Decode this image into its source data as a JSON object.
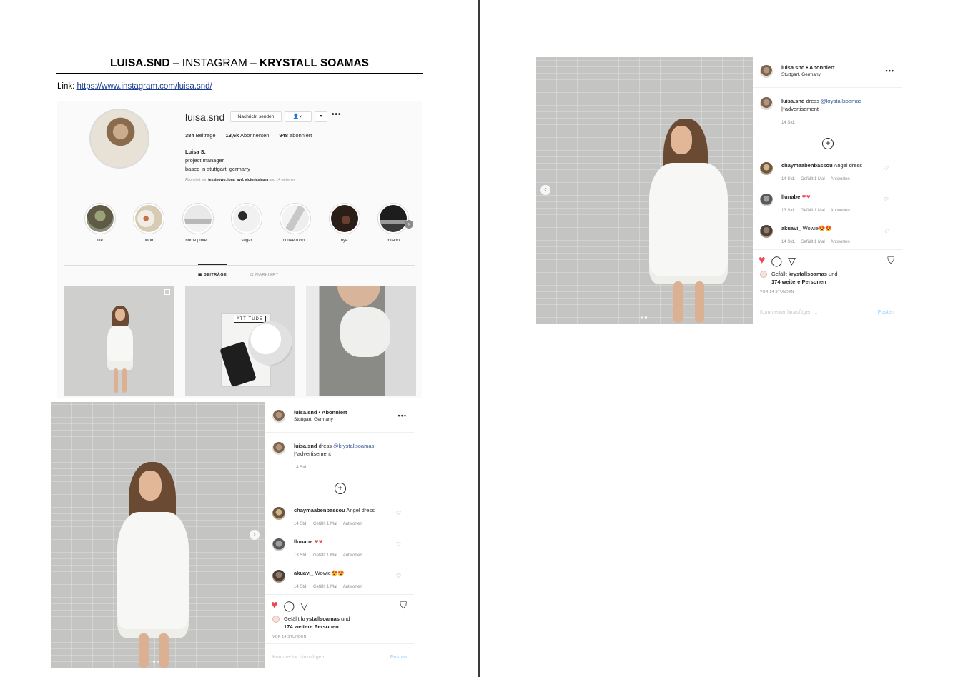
{
  "document": {
    "title_account": "LUISA.SND",
    "title_dash1": " – ",
    "title_platform": "INSTAGRAM",
    "title_dash2": " – ",
    "title_brand": "KRYSTALL SOAMAS",
    "link_label": "Link: ",
    "link_url": "https://www.instagram.com/luisa.snd/"
  },
  "profile": {
    "username": "luisa.snd",
    "message_button": "Nachricht senden",
    "follow_icon": "👤✓",
    "dropdown": "▾",
    "more": "•••",
    "stats": {
      "posts_count": "384",
      "posts_label": " Beiträge",
      "followers_count": "13,6k",
      "followers_label": " Abonnenten",
      "following_count": "948",
      "following_label": " abonniert"
    },
    "bio": {
      "name": "Luisa S.",
      "line1": "project manager",
      "line2": "based in stuttgart, germany"
    },
    "followed_by_prefix": "Abonniert von ",
    "followed_by_names": "jessinowo, iona_avd, victoriaslaura",
    "followed_by_suffix": " und 14 weiteren",
    "highlights": [
      {
        "label": "life"
      },
      {
        "label": "food"
      },
      {
        "label": "home | inte..."
      },
      {
        "label": "sugar"
      },
      {
        "label": "coffee o'clo..."
      },
      {
        "label": "nye"
      },
      {
        "label": "milano"
      }
    ],
    "highlight_next": "›",
    "tabs": {
      "posts": "▦ BEITRÄGE",
      "tagged": "⊡ MARKIERT"
    },
    "grid_book_label": "ATTITUDE"
  },
  "post": {
    "username": "luisa.snd",
    "follow_status": " • Abonniert",
    "location": "Stuttgart, Germany",
    "more": "•••",
    "caption_user": "luisa.snd",
    "caption_text": " dress ",
    "caption_mention": "@krystallsoamas",
    "caption_line2": "|*advertisement",
    "caption_time": "14 Std.",
    "plus": "+",
    "comments": [
      {
        "user": "chaymaabenbassou",
        "text": " Angel dress",
        "time": "14 Std.",
        "likes": "Gefällt 1 Mal",
        "reply": "Antworten"
      },
      {
        "user": "llunabe",
        "text": " ❤❤",
        "time": "13 Std.",
        "likes": "Gefällt 1 Mal",
        "reply": "Antworten"
      },
      {
        "user": "akuavi_",
        "text": " Wowie😍😍",
        "time": "14 Std.",
        "likes": "Gefällt 1 Mal",
        "reply": "Antworten"
      }
    ],
    "comment_heart": "♡",
    "like_icon": "♥",
    "comment_icon": "◯",
    "share_icon": "▽",
    "save_icon": "⛉",
    "likes_prefix": "Gefällt ",
    "likes_user": "krystallsoamas",
    "likes_mid": " und",
    "likes_others": "174 weitere Personen",
    "time_ago": "VOR 14 STUNDEN",
    "add_comment_placeholder": "Kommentar hinzufügen ...",
    "post_button": "Posten",
    "carousel_prev": "‹",
    "carousel_next": "›"
  }
}
